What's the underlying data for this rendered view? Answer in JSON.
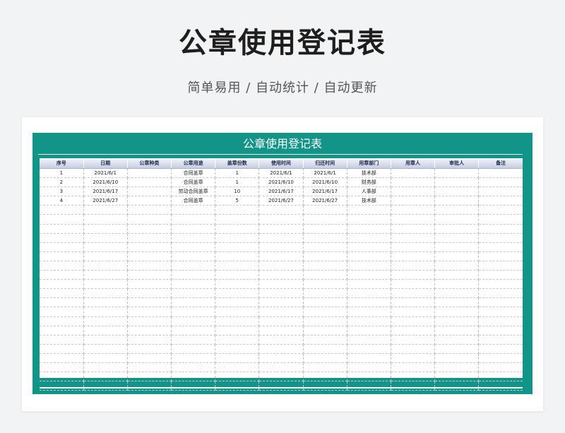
{
  "page": {
    "title": "公章使用登记表",
    "subtitle": "简单易用 / 自动统计 / 自动更新"
  },
  "sheet": {
    "title": "公章使用登记表",
    "frame_color": "#139488",
    "header_color": "#c6cde2",
    "columns": [
      "序号",
      "日期",
      "公章种类",
      "公章用途",
      "盖章份数",
      "使用时间",
      "归还时间",
      "用章部门",
      "用章人",
      "审批人",
      "备注"
    ],
    "rows": [
      [
        "1",
        "2021/6/1",
        "",
        "合同盖章",
        "1",
        "2021/6/1",
        "2021/6/1",
        "技术部",
        "",
        "",
        ""
      ],
      [
        "2",
        "2021/6/10",
        "",
        "合同盖章",
        "1",
        "2021/6/10",
        "2021/6/10",
        "财务部",
        "",
        "",
        ""
      ],
      [
        "3",
        "2021/6/17",
        "",
        "劳动合同盖章",
        "10",
        "2021/6/17",
        "2021/6/17",
        "人事部",
        "",
        "",
        ""
      ],
      [
        "4",
        "2021/6/27",
        "",
        "合同盖章",
        "5",
        "2021/6/27",
        "2021/6/27",
        "技术部",
        "",
        "",
        ""
      ]
    ],
    "blank_rows": 20
  }
}
